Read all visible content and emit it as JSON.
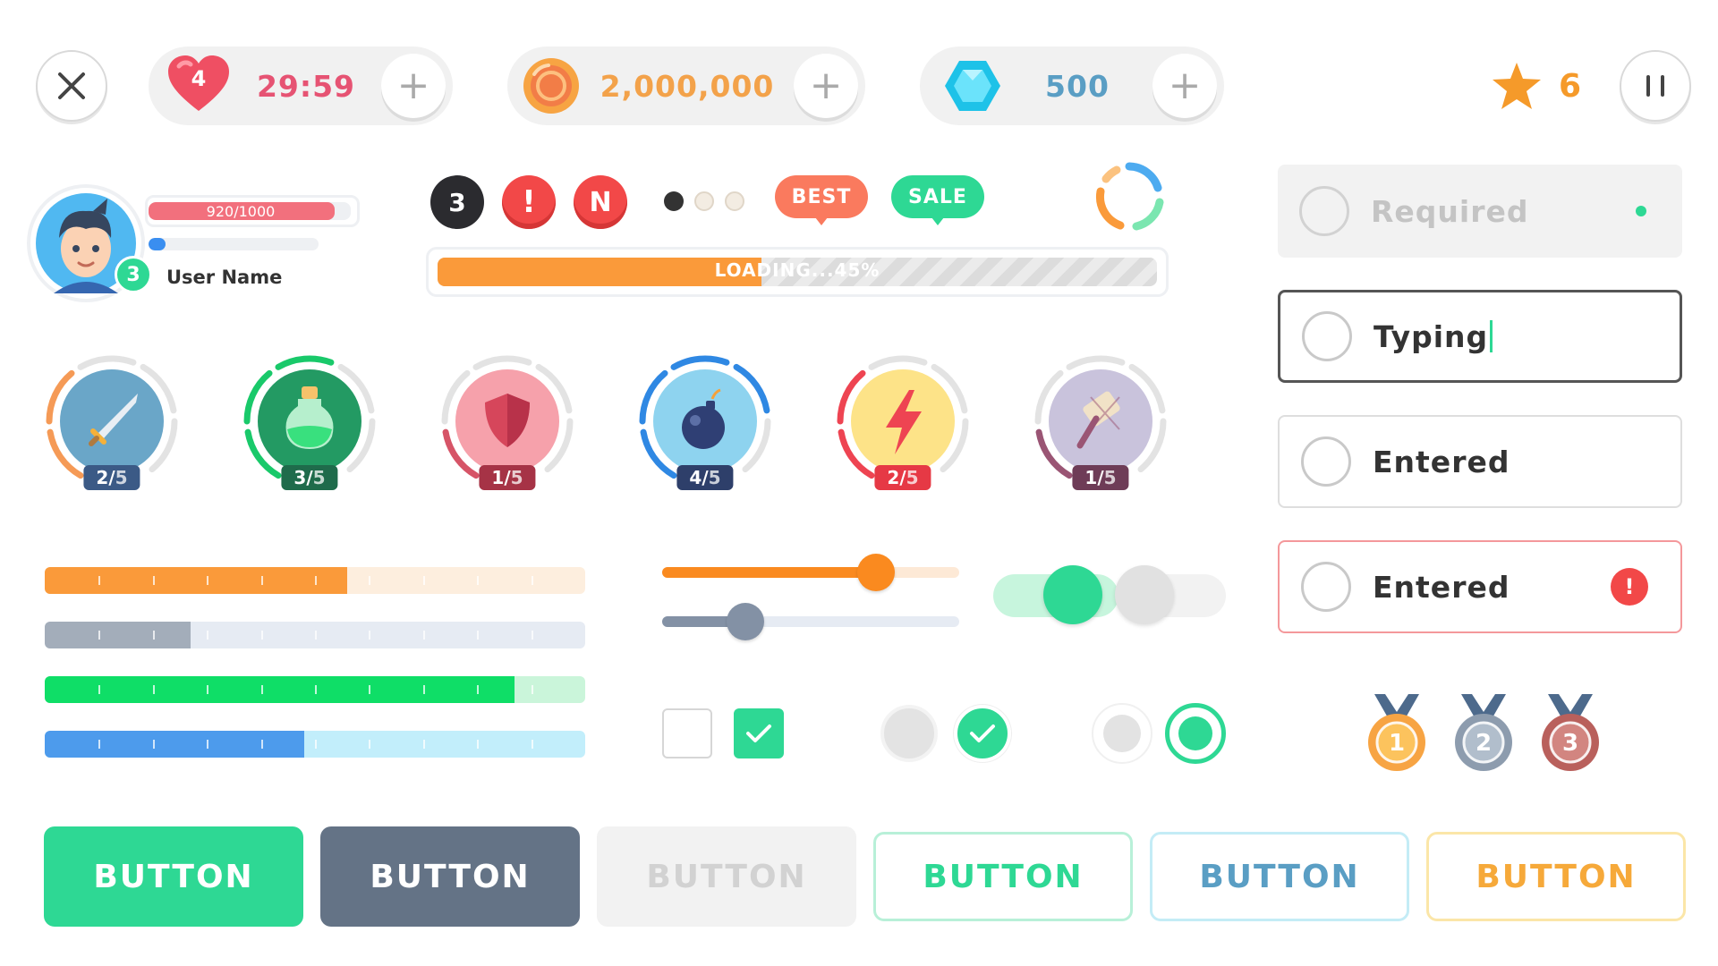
{
  "hud": {
    "close_icon": "close-icon",
    "lives": {
      "icon": "heart-icon",
      "count": "4",
      "timer": "29:59",
      "color": "#e65373"
    },
    "coins": {
      "icon": "coin-icon",
      "value": "2,000,000",
      "color": "#f3a24a"
    },
    "gems": {
      "icon": "gem-icon",
      "value": "500",
      "color": "#5a9ec4"
    },
    "stars": {
      "icon": "star-icon",
      "value": "6",
      "color": "#f59a2a"
    },
    "pause_icon": "pause-icon"
  },
  "profile": {
    "hp_text": "920/1000",
    "hp_fraction": 0.92,
    "xp_fraction": 0.1,
    "level": "3",
    "user_name": "User Name"
  },
  "badges": {
    "count": "3",
    "alert": "!",
    "new": "N",
    "best": "BEST",
    "sale": "SALE"
  },
  "loading": {
    "text": "LOADING...45%",
    "fraction": 0.45
  },
  "skills": [
    {
      "icon": "sword-icon",
      "current": "2",
      "max": "5",
      "color": "#6aa6c8",
      "ring": "#f59a56",
      "tag": "#3b5a86"
    },
    {
      "icon": "potion-icon",
      "current": "3",
      "max": "5",
      "color": "#239a63",
      "ring": "#19c96a",
      "tag": "#1f6b4b"
    },
    {
      "icon": "shield-icon",
      "current": "1",
      "max": "5",
      "color": "#f6a1ab",
      "ring": "#d65467",
      "tag": "#a63346"
    },
    {
      "icon": "bomb-icon",
      "current": "4",
      "max": "5",
      "color": "#8ed3ef",
      "ring": "#2f88e3",
      "tag": "#2e3f6a"
    },
    {
      "icon": "lightning-icon",
      "current": "2",
      "max": "5",
      "color": "#fde388",
      "ring": "#ee4452",
      "tag": "#e63945"
    },
    {
      "icon": "hammer-icon",
      "current": "1",
      "max": "5",
      "color": "#c9c3dc",
      "ring": "#9a5574",
      "tag": "#6e3c57"
    }
  ],
  "segment_bars": [
    {
      "fill": 0.56,
      "color": "#fa9a3a",
      "track": "#fdeede"
    },
    {
      "fill": 0.27,
      "color": "#a3adba",
      "track": "#e6ebf3"
    },
    {
      "fill": 0.87,
      "color": "#0fde67",
      "track": "#caf5da"
    },
    {
      "fill": 0.48,
      "color": "#4d9bec",
      "track": "#c2eefb"
    }
  ],
  "sliders": [
    {
      "value": 0.72,
      "color": "#fa8a1f",
      "track": "#fde9d6"
    },
    {
      "value": 0.28,
      "color": "#8391a5",
      "track": "#e6ebf3"
    }
  ],
  "toggles": [
    {
      "on": true
    },
    {
      "on": false
    }
  ],
  "checkboxes": [
    {
      "checked": false
    },
    {
      "checked": true
    }
  ],
  "round_checks": [
    {
      "checked": false
    },
    {
      "checked": true
    }
  ],
  "radios": [
    {
      "selected": false
    },
    {
      "selected": true
    }
  ],
  "inputs": [
    {
      "state": "disabled",
      "text": "Required"
    },
    {
      "state": "typing",
      "text": "Typing"
    },
    {
      "state": "entered",
      "text": "Entered"
    },
    {
      "state": "error",
      "text": "Entered",
      "error_icon": "!"
    }
  ],
  "medals": [
    {
      "icon": "gold-medal-icon",
      "rank": "1"
    },
    {
      "icon": "silver-medal-icon",
      "rank": "2"
    },
    {
      "icon": "bronze-medal-icon",
      "rank": "3"
    }
  ],
  "buttons": [
    {
      "label": "BUTTON",
      "style": "primary"
    },
    {
      "label": "BUTTON",
      "style": "dark"
    },
    {
      "label": "BUTTON",
      "style": "disabled"
    },
    {
      "label": "BUTTON",
      "style": "outline-green"
    },
    {
      "label": "BUTTON",
      "style": "outline-blue"
    },
    {
      "label": "BUTTON",
      "style": "outline-yellow"
    }
  ],
  "colors": {
    "accent": "#2ed894",
    "error": "#f24848"
  }
}
